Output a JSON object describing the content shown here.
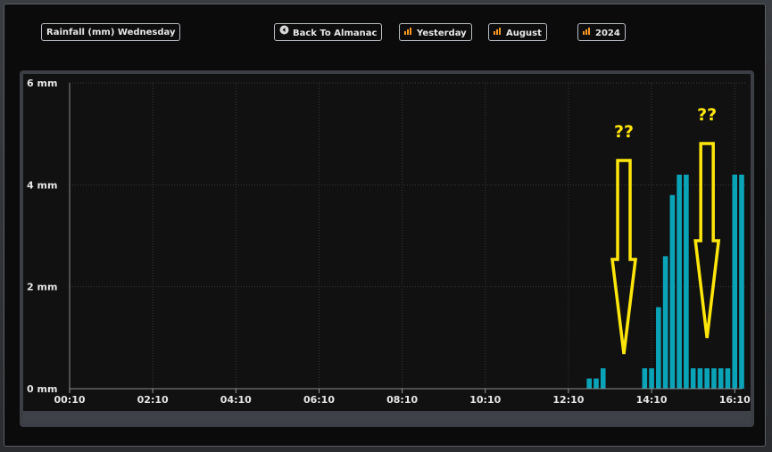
{
  "toolbar": {
    "title_label": "Rainfall (mm) Wednesday",
    "back_label": "Back To Almanac",
    "yesterday_label": "Yesterday",
    "month_label": "August",
    "year_label": "2024"
  },
  "icons": {
    "back": "back-arrow-circle-icon",
    "bar": "bar-chart-icon"
  },
  "colors": {
    "bar": "#0aa4b8",
    "annotation": "#ffe60a",
    "background": "#111111"
  },
  "annotations": {
    "left_marker": "??",
    "right_marker": "??"
  },
  "chart_data": {
    "type": "bar",
    "ylabel_unit": "mm",
    "ylim": [
      0,
      6
    ],
    "yticks": [
      "0 mm",
      "2 mm",
      "4 mm",
      "6 mm"
    ],
    "xticks": [
      "00:10",
      "02:10",
      "04:10",
      "06:10",
      "08:10",
      "10:10",
      "12:10",
      "14:10",
      "16:10"
    ],
    "xlim_minutes": [
      10,
      980
    ],
    "grid": true,
    "bars": [
      {
        "t": "12:40",
        "value": 0.2
      },
      {
        "t": "12:50",
        "value": 0.2
      },
      {
        "t": "13:00",
        "value": 0.4
      },
      {
        "t": "14:00",
        "value": 0.4
      },
      {
        "t": "14:10",
        "value": 0.4
      },
      {
        "t": "14:20",
        "value": 1.6
      },
      {
        "t": "14:30",
        "value": 2.6
      },
      {
        "t": "14:40",
        "value": 3.8
      },
      {
        "t": "14:50",
        "value": 4.2
      },
      {
        "t": "15:00",
        "value": 4.2
      },
      {
        "t": "15:10",
        "value": 0.4
      },
      {
        "t": "15:20",
        "value": 0.4
      },
      {
        "t": "15:30",
        "value": 0.4
      },
      {
        "t": "15:40",
        "value": 0.4
      },
      {
        "t": "15:50",
        "value": 0.4
      },
      {
        "t": "16:00",
        "value": 0.4
      },
      {
        "t": "16:10",
        "value": 4.2
      },
      {
        "t": "16:20",
        "value": 4.2
      }
    ],
    "annotated_times": [
      "13:30",
      "15:30"
    ]
  }
}
